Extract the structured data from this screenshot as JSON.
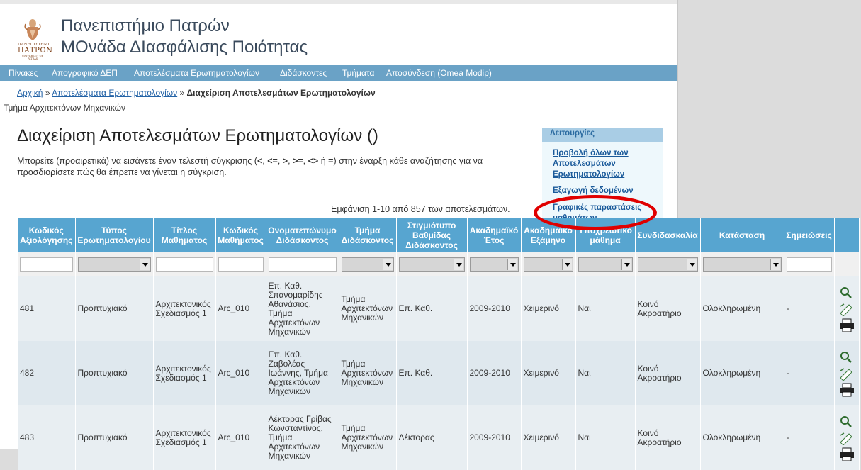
{
  "site": {
    "title_line1": "Πανεπιστήμιο Πατρών",
    "title_line2": "ΜΟνάδα ΔΙασφάλισης Ποιότητας",
    "logo_text_big": "ΠΑΝΕΠΙΣΤΗΜΙΟ",
    "logo_text_name": "ΠΑΤΡΩΝ",
    "logo_text_small": "UNIVERSITY OF PATRAS"
  },
  "nav": [
    {
      "label": "Πίνακες"
    },
    {
      "label": "Απογραφικό ΔΕΠ"
    },
    {
      "label": "Αποτελέσματα Ερωτηματολογίων"
    },
    {
      "label": "Διδάσκοντες"
    },
    {
      "label": "Τμήματα"
    },
    {
      "label": "Αποσύνδεση (Omea Modip)"
    }
  ],
  "breadcrumb": {
    "home": "Αρχική",
    "sep": "»",
    "parent": "Αποτελέσματα Ερωτηματολογίων",
    "current": "Διαχείριση Αποτελεσμάτων Ερωτηματολογίων"
  },
  "department": "Τμήμα Αρχιτεκτόνων Μηχανικών",
  "page_title": "Διαχείριση Αποτελεσμάτων Ερωτηματολογίων ()",
  "intro": {
    "part1": "Μπορείτε (προαιρετικά) να εισάγετε έναν τελεστή σύγκρισης (",
    "op1": "<",
    "op2": "<=",
    "op3": ">",
    "op4": ">=",
    "op5": "<>",
    "mid": " ή ",
    "op6": "=",
    "part2": ") στην έναρξη κάθε αναζήτησης για να προσδιορίσετε πώς θα έπρεπε να γίνεται η σύγκριση."
  },
  "results_count": "Εμφάνιση 1-10 από 857 των αποτελεσμάτων.",
  "operations": {
    "header": "Λειτουργίες",
    "view_all": "Προβολή όλων των Αποτελεσμάτων Ερωτηματολογίων",
    "export": "Εξαγωγή δεδομένων",
    "charts": "Γραφικές παραστάσεις μαθημάτων"
  },
  "table": {
    "headers": [
      "Κωδικός Αξιολόγησης",
      "Τύπος Ερωτηματολογίου",
      "Τίτλος Μαθήματος",
      "Κωδικός Μαθήματος",
      "Ονοματεπώνυμο Διδάσκοντος",
      "Τμήμα Διδάσκοντος",
      "Στιγμιότυπο Βαθμίδας Διδάσκοντος",
      "Ακαδημαϊκό Έτος",
      "Ακαδημαϊκό Εξάμηνο",
      "Υποχρεωτικό μάθημα",
      "Συνδιδασκαλία",
      "Κατάσταση",
      "Σημειώσεις",
      ""
    ],
    "rows": [
      {
        "code": "481",
        "type": "Προπτυχιακό",
        "course": "Αρχιτεκτονικός Σχεδιασμός 1",
        "course_code": "Arc_010",
        "instructor": "Επ. Καθ. Σπανομαρίδης Αθανάσιος, Τμήμα Αρχιτεκτόνων Μηχανικών",
        "dept": "Τμήμα Αρχιτεκτόνων Μηχανικών",
        "rank": "Επ. Καθ.",
        "year": "2009-2010",
        "semester": "Χειμερινό",
        "mandatory": "Ναι",
        "coteach": "Κοινό Ακροατήριο",
        "status": "Ολοκληρωμένη",
        "notes": "-"
      },
      {
        "code": "482",
        "type": "Προπτυχιακό",
        "course": "Αρχιτεκτονικός Σχεδιασμός 1",
        "course_code": "Arc_010",
        "instructor": "Επ. Καθ. Ζαβολέας Ιωάννης, Τμήμα Αρχιτεκτόνων Μηχανικών",
        "dept": "Τμήμα Αρχιτεκτόνων Μηχανικών",
        "rank": "Επ. Καθ.",
        "year": "2009-2010",
        "semester": "Χειμερινό",
        "mandatory": "Ναι",
        "coteach": "Κοινό Ακροατήριο",
        "status": "Ολοκληρωμένη",
        "notes": "-"
      },
      {
        "code": "483",
        "type": "Προπτυχιακό",
        "course": "Αρχιτεκτονικός Σχεδιασμός 1",
        "course_code": "Arc_010",
        "instructor": "Λέκτορας Γρίβας Κωνσταντίνος, Τμήμα Αρχιτεκτόνων Μηχανικών",
        "dept": "Τμήμα Αρχιτεκτόνων Μηχανικών",
        "rank": "Λέκτορας",
        "year": "2009-2010",
        "semester": "Χειμερινό",
        "mandatory": "Ναι",
        "coteach": "Κοινό Ακροατήριο",
        "status": "Ολοκληρωμένη",
        "notes": "-"
      }
    ]
  },
  "icons": {
    "view": "magnifier-icon",
    "edit": "pencil-icon",
    "print": "printer-icon"
  },
  "colors": {
    "navbar": "#6aa2c6",
    "table_header": "#57a5d0",
    "link": "#2262a6",
    "highlight_circle": "#e00000"
  }
}
